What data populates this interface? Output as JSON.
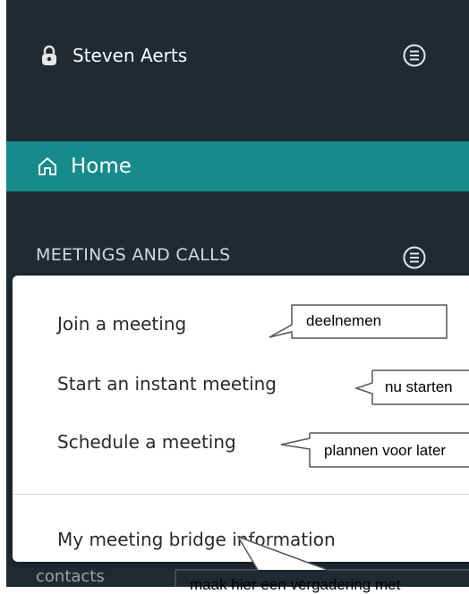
{
  "sidebar": {
    "user_name": "Steven Aerts",
    "home_label": "Home",
    "section_title": "MEETINGS AND CALLS",
    "contacts_label": "contacts"
  },
  "meeting_menu": {
    "items": [
      {
        "label": "Join a meeting"
      },
      {
        "label": "Start an instant meeting"
      },
      {
        "label": "Schedule a meeting"
      },
      {
        "label": "My meeting bridge information"
      }
    ]
  },
  "annotations": {
    "join": "deelnemen",
    "instant": "nu starten",
    "schedule": "plannen voor later",
    "bridge": "maak hier een vergadering met"
  },
  "colors": {
    "sidebar_bg": "#1f2a33",
    "home_highlight": "#168b8b"
  }
}
